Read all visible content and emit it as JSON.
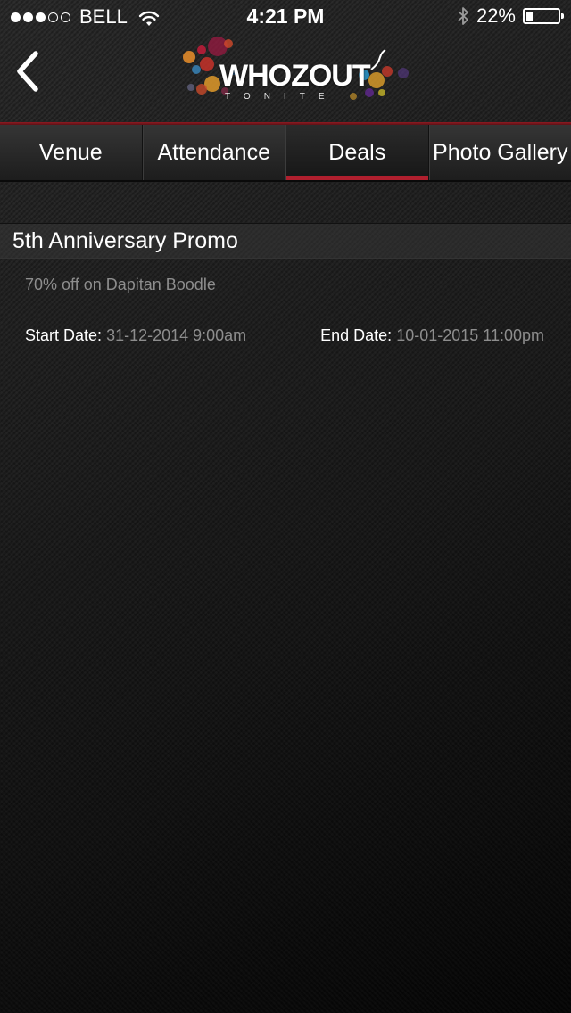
{
  "status_bar": {
    "signal_filled": 3,
    "signal_total": 5,
    "carrier": "BELL",
    "time": "4:21 PM",
    "battery_text": "22%",
    "battery_level": 0.22
  },
  "nav": {
    "back_icon": "chevron-left-icon",
    "logo": {
      "word": "WHOZOUT",
      "subtitle": "TONITE"
    }
  },
  "tabs": [
    {
      "label": "Venue",
      "active": false
    },
    {
      "label": "Attendance",
      "active": false
    },
    {
      "label": "Deals",
      "active": true
    },
    {
      "label": "Photo Gallery",
      "active": false
    }
  ],
  "deal": {
    "title": "5th Anniversary Promo",
    "description": "70% off on Dapitan Boodle",
    "start_label": "Start Date:",
    "start_value": "31-12-2014  9:00am",
    "end_label": "End Date:",
    "end_value": "10-01-2015  11:00pm"
  },
  "colors": {
    "accent": "#b01f2e",
    "nav_divider": "#8e1b22",
    "muted_text": "#8d8d8d",
    "background": "#1c1c1c"
  }
}
